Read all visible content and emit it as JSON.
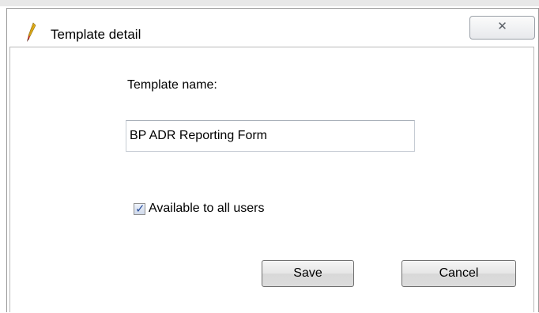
{
  "window": {
    "title": "Template detail",
    "app_icon": "quill-pen-icon",
    "close_glyph": "✕"
  },
  "form": {
    "name_label": "Template name:",
    "name_value": "BP ADR Reporting Form",
    "available_label": "Available to all users",
    "available_checked": true
  },
  "buttons": {
    "save_label": "Save",
    "cancel_label": "Cancel"
  },
  "colors": {
    "check_accent": "#2a4f9e",
    "pen_yellow": "#e8b41a",
    "pen_red": "#b8301e"
  }
}
